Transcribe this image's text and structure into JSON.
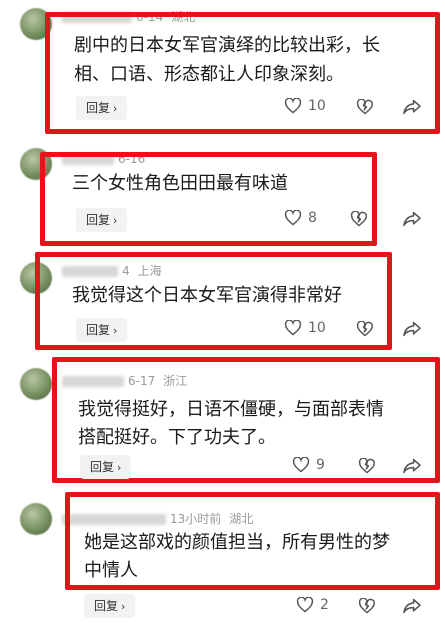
{
  "comments": [
    {
      "date": "6-14",
      "location": "湖北",
      "text": "剧中的日本女军官演绎的比较出彩，长相、口语、形态都让人印象深刻。",
      "line1": "剧中的日本女军官演绎的比较出彩，长",
      "line2": "相、口语、形态都让人印象深刻。",
      "reply_label": "回复",
      "likes": "10"
    },
    {
      "date": "6-16",
      "location": "",
      "text": "三个女性角色田田最有味道",
      "line1": "三个女性角色田田最有味道",
      "reply_label": "回复",
      "likes": "8"
    },
    {
      "date": "4",
      "location": "上海",
      "text": "我觉得这个日本女军官演得非常好",
      "line1": "我觉得这个日本女军官演得非常好",
      "reply_label": "回复",
      "likes": "10"
    },
    {
      "date": "6-17",
      "location": "浙江",
      "text": "我觉得挺好，日语不僵硬，与面部表情搭配挺好。下了功夫了。",
      "line1": "我觉得挺好，日语不僵硬，与面部表情",
      "line2": "搭配挺好。下了功夫了。",
      "reply_label": "回复",
      "likes": "9"
    },
    {
      "date": "13小时前",
      "location": "湖北",
      "text": "她是这部戏的颜值担当，所有男性的梦中情人",
      "line1": "她是这部戏的颜值担当，所有男性的梦",
      "line2": "中情人",
      "reply_label": "回复",
      "likes": "2"
    }
  ],
  "colors": {
    "highlight_frame": "#e5141b",
    "reply_bg": "#f2f2f2",
    "meta_text": "#9a9a9a"
  },
  "icons": [
    "heart-icon",
    "broken-heart-icon",
    "share-icon",
    "chevron-right-icon"
  ]
}
